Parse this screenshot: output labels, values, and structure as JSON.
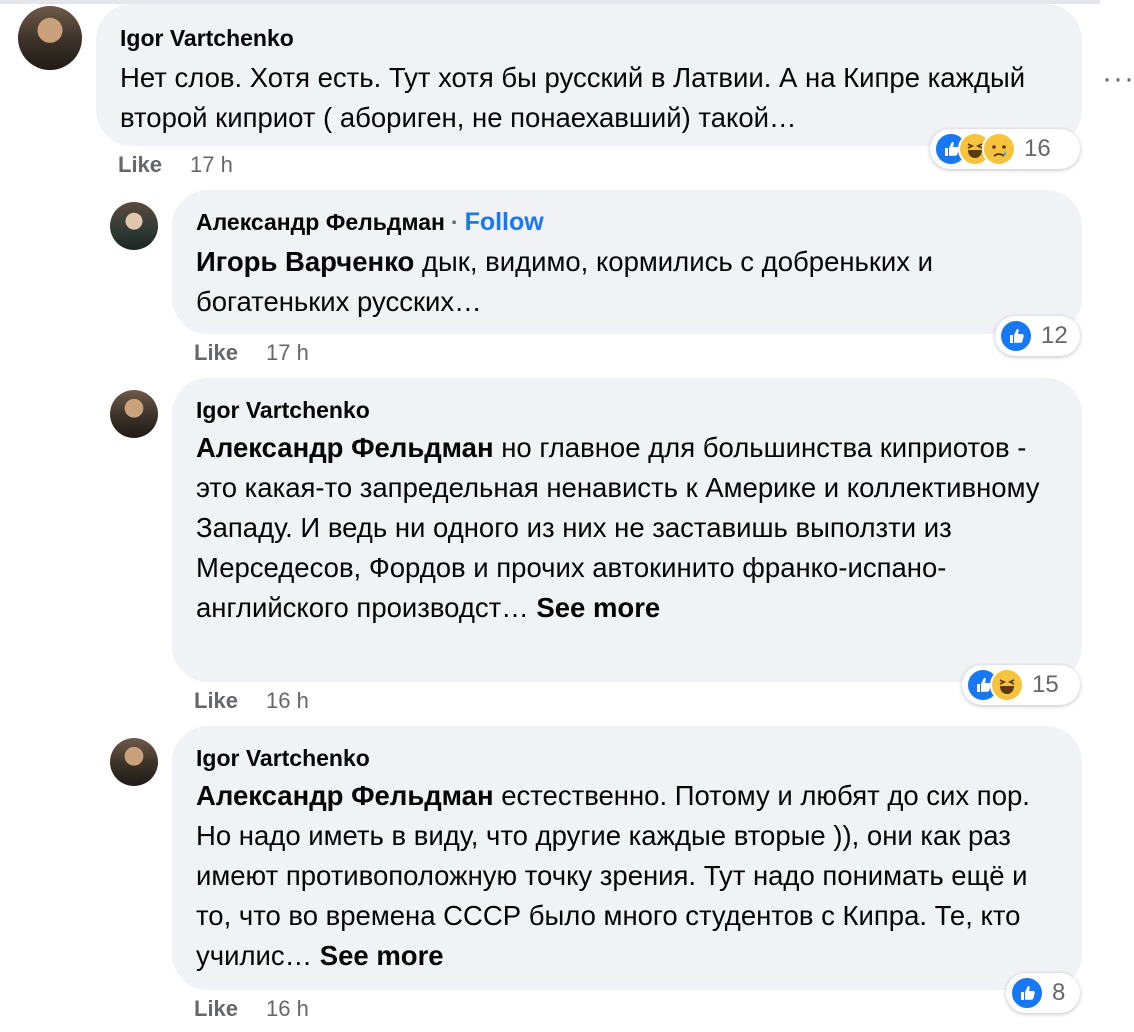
{
  "comments": [
    {
      "author": "Igor Vartchenko",
      "text": "Нет слов. Хотя есть. Тут хотя бы русский в Латвии. А на Кипре каждый второй киприот ( абориген, не понаехавший) такой…",
      "like": "Like",
      "time": "17 h",
      "reactions": [
        "like",
        "haha",
        "sad"
      ],
      "reaction_count": "16"
    },
    {
      "author": "Александр Фельдман",
      "follow": "Follow",
      "follow_separator": "·",
      "mention": "Игорь Варченко",
      "text": " дык, видимо, кормились с добреньких и богатеньких русских…",
      "like": "Like",
      "time": "17 h",
      "reactions": [
        "like"
      ],
      "reaction_count": "12"
    },
    {
      "author": "Igor Vartchenko",
      "mention": "Александр Фельдман",
      "text": " но главное для большинства киприотов - это какая-то запредельная ненависть к Америке и коллективному Западу. И ведь ни одного из них не заставишь выползти из Мерседесов, Фордов и прочих автокинито франко-испано-английского производст… ",
      "see_more": "See more",
      "like": "Like",
      "time": "16 h",
      "reactions": [
        "like",
        "haha"
      ],
      "reaction_count": "15"
    },
    {
      "author": "Igor Vartchenko",
      "mention": "Александр Фельдман",
      "text": " естественно. Потому и любят до сих пор. Но надо иметь в виду, что другие каждые вторые )), они как раз имеют противоположную точку зрения. Тут надо понимать ещё и то, что во времена СССР было много студентов с Кипра. Те, кто училис… ",
      "see_more": "See more",
      "like": "Like",
      "time": "16 h",
      "reactions": [
        "like"
      ],
      "reaction_count": "8"
    }
  ],
  "more_options": "···",
  "colors": {
    "bubble": "#f0f2f5",
    "link": "#1877f2",
    "meta": "#65676b",
    "like_reaction": "#1877f2",
    "emoji_yellow": "#f7c23c"
  }
}
